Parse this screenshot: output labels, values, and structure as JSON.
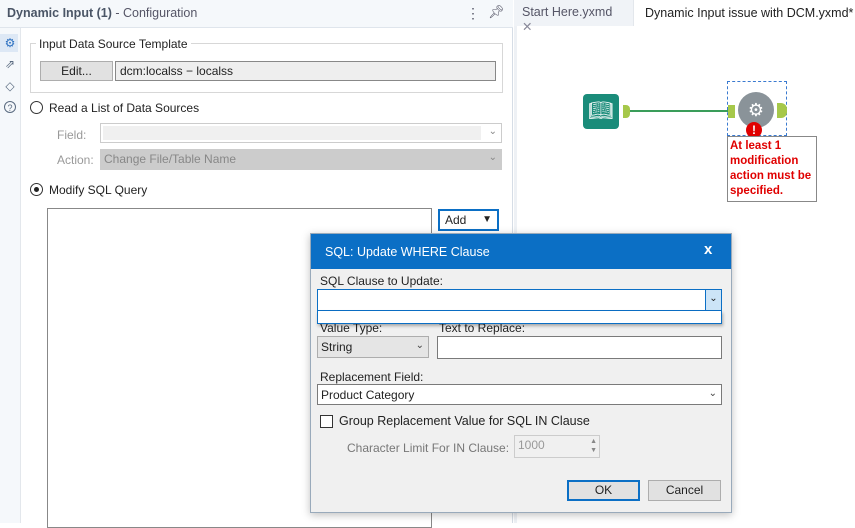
{
  "panel": {
    "title_bold": "Dynamic Input (1)",
    "title_rest": " - Configuration",
    "menu_icon": "kebab-icon",
    "pin_icon": "pin-icon"
  },
  "sidebar": [
    "gear-icon",
    "arrow-circle-icon",
    "tag-icon",
    "help-icon"
  ],
  "template": {
    "group_label": "Input Data Source Template",
    "edit_label": "Edit...",
    "source_value": "dcm:localss − localss"
  },
  "read_list": {
    "label": "Read a List of Data Sources",
    "field_label": "Field:",
    "field_value": "",
    "action_label": "Action:",
    "action_value": "Change File/Table Name"
  },
  "modify_sql": {
    "label": "Modify SQL Query",
    "add_label": "Add"
  },
  "tabs": [
    {
      "label": "Start Here.yxmd"
    },
    {
      "label": "Dynamic Input issue with DCM.yxmd*"
    }
  ],
  "canvas": {
    "error_text": "At least 1 modification action must be specified.",
    "accent": "#1a8c7a",
    "error_color": "#e00000"
  },
  "dialog": {
    "title": "SQL: Update WHERE Clause",
    "close": "x",
    "clause_label": "SQL Clause to Update:",
    "clause_value": "",
    "value_type_label": "Value Type:",
    "value_type": "String",
    "text_replace_label": "Text to Replace:",
    "text_replace_value": "",
    "replacement_label": "Replacement Field:",
    "replacement_value": "Product Category",
    "group_label": "Group Replacement Value for SQL IN Clause",
    "group_checked": false,
    "limit_label": "Character Limit For IN Clause:",
    "limit_value": "1000",
    "ok": "OK",
    "cancel": "Cancel",
    "accent": "#0b6fc5"
  }
}
